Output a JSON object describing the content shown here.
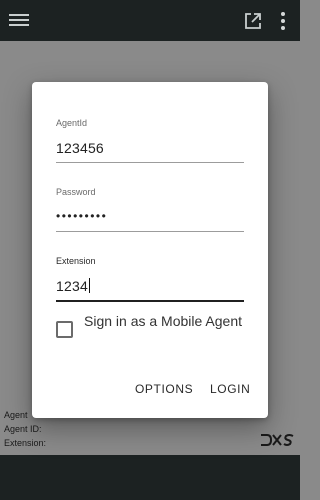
{
  "header": {
    "menu_icon": "hamburger-menu-icon",
    "popout_icon": "open-in-new-icon",
    "more_icon": "more-vert-icon"
  },
  "dialog": {
    "agent_id": {
      "label": "AgentId",
      "value": "123456"
    },
    "password": {
      "label": "Password",
      "value": "•••••••••"
    },
    "extension": {
      "label": "Extension",
      "value": "1234"
    },
    "mobile_agent": {
      "label": "Sign in as a Mobile Agent",
      "checked": false
    },
    "buttons": {
      "options": "OPTIONS",
      "login": "LOGIN"
    }
  },
  "footer_info": {
    "agent_label": "Agent",
    "agent_id_label": "Agent ID:",
    "extension_label": "Extension:"
  },
  "logo_text": "DXS",
  "colors": {
    "topbar": "#1c2222",
    "overlay": "#8a8a8a",
    "dialog_bg": "#ffffff",
    "text_dark": "#222222"
  }
}
